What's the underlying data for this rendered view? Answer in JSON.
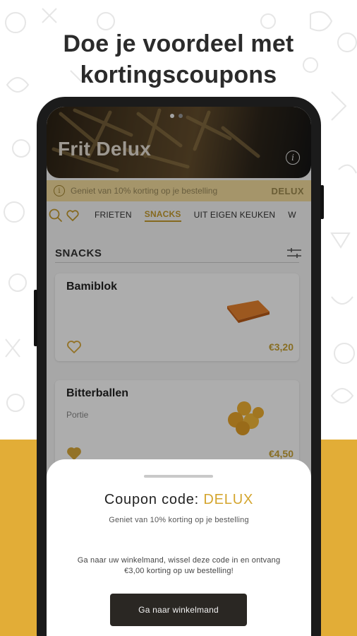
{
  "promo": {
    "headline_line1": "Doe je voordeel met",
    "headline_line2": "kortingscoupons"
  },
  "colors": {
    "accent": "#e2ad37",
    "gold_text": "#d4a52e",
    "button_dark": "#2a2723"
  },
  "restaurant": {
    "name": "Frit Delux",
    "carousel_pages": 2,
    "carousel_active": 1
  },
  "discount_bar": {
    "text": "Geniet van 10% korting op je bestelling",
    "code": "DELUX"
  },
  "tabs": {
    "items": [
      {
        "label": "FRIETEN",
        "active": false
      },
      {
        "label": "SNACKS",
        "active": true
      },
      {
        "label": "UIT EIGEN KEUKEN",
        "active": false
      },
      {
        "label": "W",
        "active": false
      }
    ]
  },
  "section": {
    "title": "SNACKS"
  },
  "products": [
    {
      "name": "Bamiblok",
      "description": "",
      "price": "€3,20",
      "favorite": false,
      "image_icon": "bamiblok-image"
    },
    {
      "name": "Bitterballen",
      "description": "Portie",
      "price": "€4,50",
      "favorite": true,
      "image_icon": "bitterballen-image"
    }
  ],
  "sheet": {
    "title_prefix": "Coupon code:",
    "code": "DELUX",
    "subtitle": "Geniet van 10% korting op je bestelling",
    "info": "Ga naar uw winkelmand, wissel deze code in en ontvang €3,00 korting op uw bestelling!",
    "button_label": "Ga naar winkelmand"
  }
}
